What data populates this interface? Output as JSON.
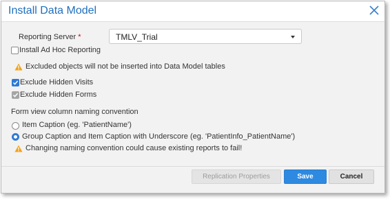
{
  "dialog": {
    "title": "Install Data Model"
  },
  "form": {
    "reporting_server_label": "Reporting Server",
    "required_mark": "*",
    "reporting_server_value": "TMLV_Trial",
    "install_adhoc_label": "Install Ad Hoc Reporting",
    "install_adhoc_checked": false,
    "excluded_warning": "Excluded objects will not be inserted into Data Model tables",
    "exclude_visits_label": "Exclude Hidden Visits",
    "exclude_visits_checked": true,
    "exclude_forms_label": "Exclude Hidden Forms",
    "exclude_forms_checked": true,
    "naming_convention_label": "Form view column naming convention",
    "naming_options": [
      {
        "label": "Item Caption (eg. 'PatientName')",
        "selected": false
      },
      {
        "label": "Group Caption and Item Caption with Underscore (eg. 'PatientInfo_PatientName')",
        "selected": true
      }
    ],
    "naming_warning": "Changing naming convention could cause existing reports to fail!"
  },
  "footer": {
    "replication_label": "Replication Properties",
    "save_label": "Save",
    "cancel_label": "Cancel"
  },
  "colors": {
    "accent": "#2d8ae0",
    "title": "#1e6fbf",
    "warning": "#f0a21a"
  },
  "icons": [
    "close-icon",
    "chevron-down-icon",
    "warning-icon",
    "checkmark-icon"
  ]
}
